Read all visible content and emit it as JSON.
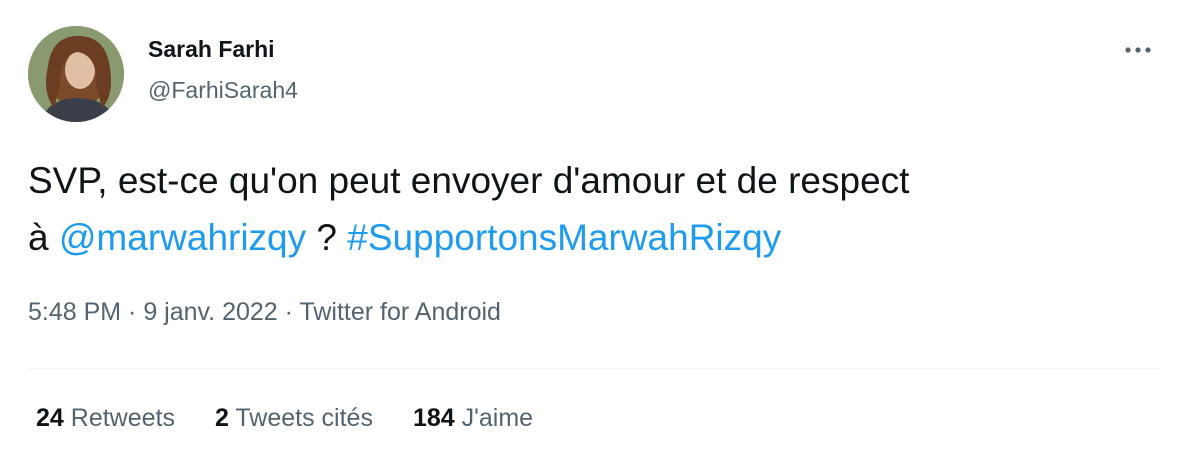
{
  "author": {
    "name": "Sarah Farhi",
    "handle": "@FarhiSarah4"
  },
  "icons": {
    "more": "more-horizontal-icon",
    "avatar": "profile-photo"
  },
  "tweet": {
    "line1": "SVP, est-ce qu'on peut envoyer d'amour et de respect",
    "prefix": "à ",
    "mention": "@marwahrizqy",
    "middle": " ? ",
    "hashtag": "#SupportonsMarwahRizqy"
  },
  "meta": {
    "time": "5:48 PM",
    "sep1": " · ",
    "date": "9 janv. 2022",
    "sep2": " · ",
    "source": "Twitter for Android"
  },
  "stats": {
    "retweets_count": "24",
    "retweets_label": "Retweets",
    "quotes_count": "2",
    "quotes_label": "Tweets cités",
    "likes_count": "184",
    "likes_label": "J'aime"
  },
  "colors": {
    "link": "#1d9bf0",
    "secondary_text": "#536471",
    "primary_text": "#0f1419",
    "divider": "#eff3f4"
  }
}
